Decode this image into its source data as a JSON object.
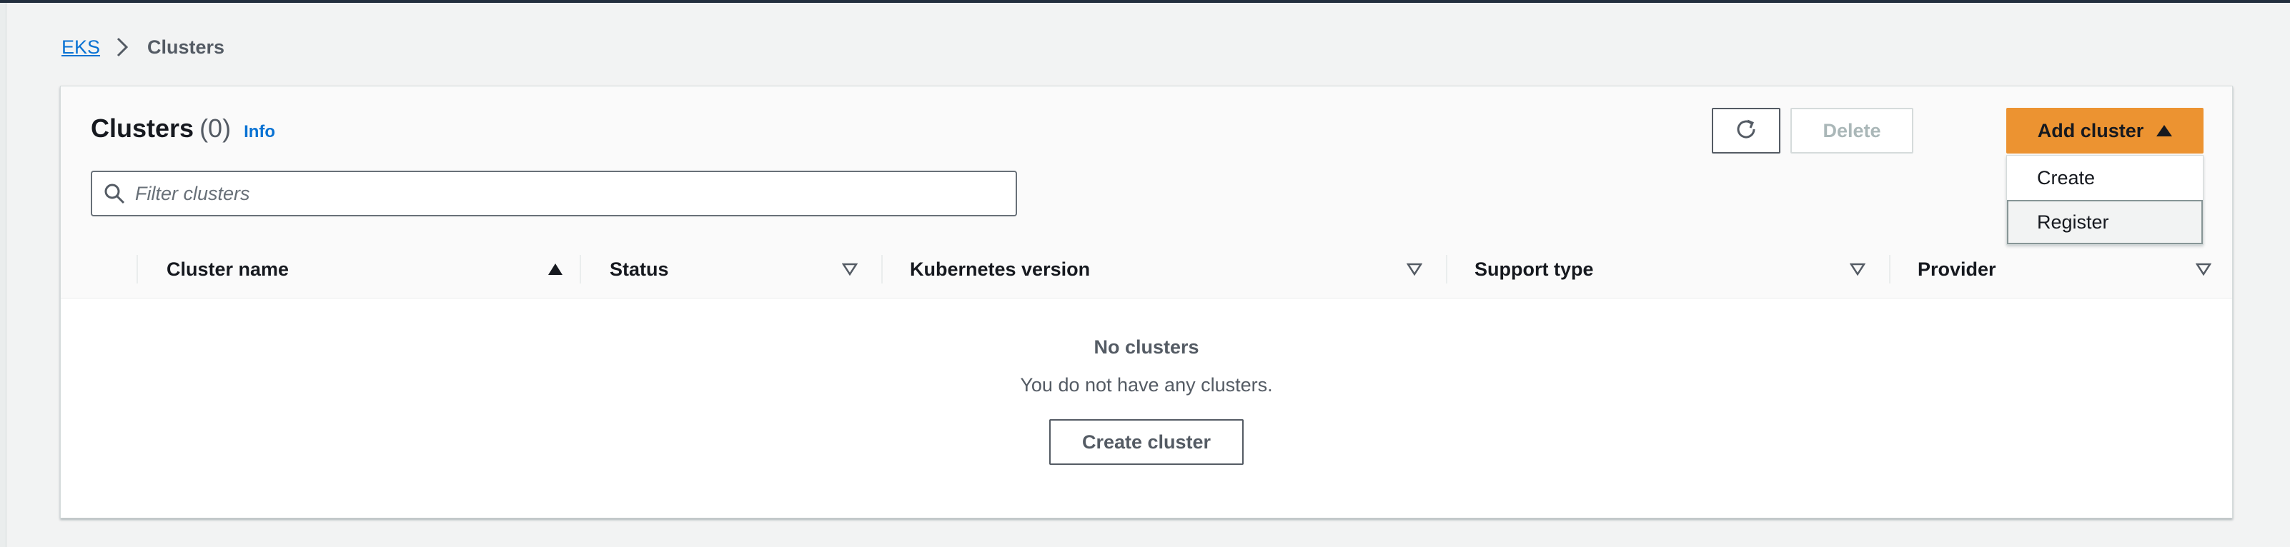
{
  "breadcrumb": {
    "root": "EKS",
    "current": "Clusters"
  },
  "header": {
    "title": "Clusters",
    "count": "(0)",
    "info": "Info"
  },
  "actions": {
    "delete_label": "Delete",
    "add_cluster_label": "Add cluster",
    "add_cluster_menu": [
      "Create",
      "Register"
    ]
  },
  "filter": {
    "placeholder": "Filter clusters",
    "value": ""
  },
  "table": {
    "columns": [
      "Cluster name",
      "Status",
      "Kubernetes version",
      "Support type",
      "Provider"
    ]
  },
  "empty_state": {
    "title": "No clusters",
    "message": "You do not have any clusters.",
    "button": "Create cluster"
  },
  "colors": {
    "primary_button": "#ec9331",
    "link": "#0972d3",
    "background": "#f2f3f3"
  }
}
